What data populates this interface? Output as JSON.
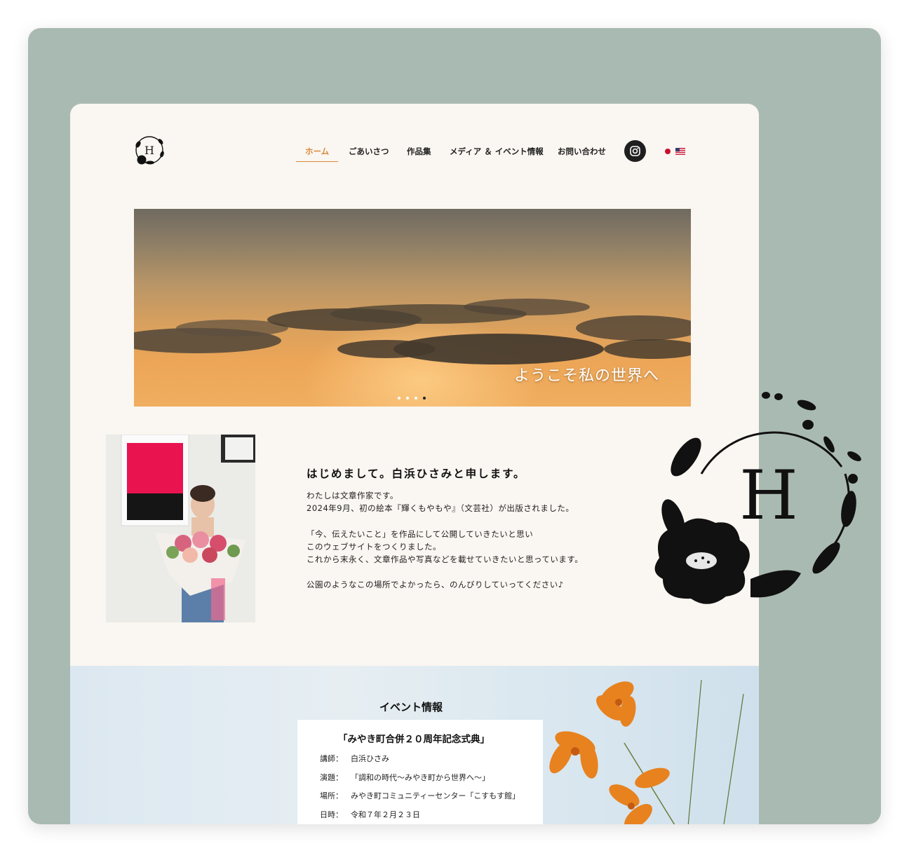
{
  "nav": {
    "items": [
      {
        "label": "ホーム",
        "active": true
      },
      {
        "label": "ごあいさつ",
        "active": false
      },
      {
        "label": "作品集",
        "active": false
      },
      {
        "label": "メディア ＆ イベント情報",
        "active": false
      },
      {
        "label": "お問い合わせ",
        "active": false
      }
    ],
    "logo_letter": "H",
    "social": "instagram-icon",
    "languages": [
      "japan-flag",
      "us-flag"
    ],
    "accent": "#d98a3d"
  },
  "hero": {
    "caption": "ようこそ私の世界へ",
    "slides": 4,
    "active_slide": 4
  },
  "intro": {
    "title": "はじめまして。白浜ひさみと申します。",
    "lines": [
      "わたしは文章作家です。",
      "2024年9月、初の絵本『輝くもやもや』（文芸社）が出版されました。",
      "",
      "「今、伝えたいこと」を作品にして公開していきたいと思い",
      "このウェブサイトをつくりました。",
      "これから末永く、文章作品や写真などを載せていきたいと思っています。",
      "",
      "公園のようなこの場所でよかったら、のんびりしていってください♪"
    ]
  },
  "event": {
    "heading": "イベント情報",
    "title": "「みやき町合併２０周年記念式典」",
    "rows": [
      {
        "key": "講師：",
        "value": "白浜ひさみ"
      },
      {
        "key": "演題：",
        "value": "「調和の時代〜みやき町から世界へ〜」"
      },
      {
        "key": "場所：",
        "value": "みやき町コミュニティーセンター「こすもす館」"
      },
      {
        "key": "日時：",
        "value": "令和７年２月２３日"
      }
    ]
  },
  "emblem": {
    "letter": "H"
  },
  "colors": {
    "frame": "#a9bab2",
    "page": "#faf6f1",
    "accent": "#d98a3d"
  }
}
